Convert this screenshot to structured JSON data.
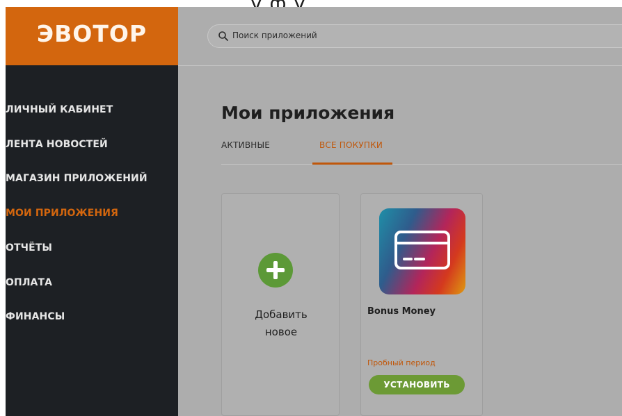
{
  "top_banner": "у   ф         у",
  "logo": {
    "text": "ЭВОТОР"
  },
  "nav": {
    "items": [
      {
        "label": "ЛИЧНЫЙ КАБИНЕТ",
        "active": false
      },
      {
        "label": "ЛЕНТА НОВОСТЕЙ",
        "active": false
      },
      {
        "label": "МАГАЗИН ПРИЛОЖЕНИЙ",
        "active": false
      },
      {
        "label": "МОИ ПРИЛОЖЕНИЯ",
        "active": true
      },
      {
        "label": "ОТЧЁТЫ",
        "active": false
      },
      {
        "label": "ОПЛАТА",
        "active": false
      },
      {
        "label": "ФИНАНСЫ",
        "active": false
      }
    ]
  },
  "search": {
    "placeholder": "Поиск приложений",
    "icon": "search-icon"
  },
  "main": {
    "title": "Мои приложения",
    "tabs": [
      {
        "label": "АКТИВНЫЕ",
        "active": false
      },
      {
        "label": "ВСЕ ПОКУПКИ",
        "active": true
      }
    ]
  },
  "cards": {
    "add": {
      "line1": "Добавить",
      "line2": "новое",
      "icon": "plus-icon"
    },
    "app": {
      "name": "Bonus Money",
      "status": "Пробный период",
      "install_label": "УСТАНОВИТЬ",
      "icon": "credit-card-icon"
    }
  },
  "colors": {
    "accent": "#d3660e",
    "sidebar_bg": "#1d2024",
    "install_button": "#6c9a35",
    "add_button": "#5c9937"
  }
}
